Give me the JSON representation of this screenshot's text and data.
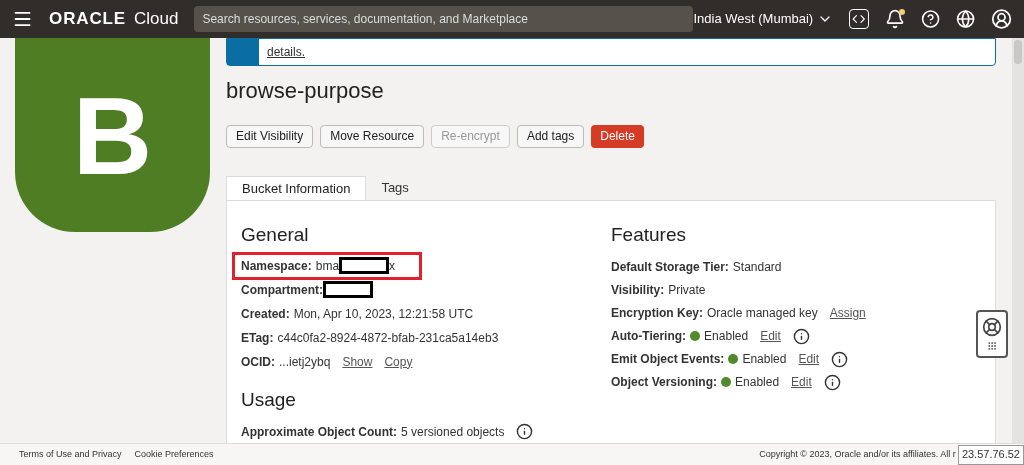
{
  "header": {
    "brand": "ORACLE",
    "product": "Cloud",
    "search": {
      "placeholder": "Search resources, services, documentation, and Marketplace"
    },
    "region": "India West (Mumbai)",
    "notification": true
  },
  "banner": {
    "link": "details."
  },
  "bucket": {
    "letter": "B",
    "title": "browse-purpose"
  },
  "actions": [
    {
      "label": "Edit Visibility",
      "kind": "default",
      "disabled": false
    },
    {
      "label": "Move Resource",
      "kind": "default",
      "disabled": false
    },
    {
      "label": "Re-encrypt",
      "kind": "default",
      "disabled": true
    },
    {
      "label": "Add tags",
      "kind": "default",
      "disabled": false
    },
    {
      "label": "Delete",
      "kind": "danger",
      "disabled": false
    }
  ],
  "tabs": [
    {
      "label": "Bucket Information",
      "selected": true
    },
    {
      "label": "Tags",
      "selected": false
    }
  ],
  "general": {
    "heading": "General",
    "rows": [
      {
        "label": "Namespace:",
        "before": "bma",
        "after": "x",
        "redacted": true,
        "highlighted": true
      },
      {
        "label": "Compartment:",
        "redacted": true
      },
      {
        "label": "Created:",
        "value": "Mon, Apr 10, 2023, 12:21:58 UTC"
      },
      {
        "label": "ETag:",
        "value": "c44c0fa2-8924-4872-bfab-231ca5a14eb3"
      },
      {
        "label": "OCID:",
        "value": "...ietj2ybq",
        "links": [
          "Show",
          "Copy"
        ]
      }
    ]
  },
  "usage": {
    "heading": "Usage",
    "rows": [
      {
        "label": "Approximate Object Count:",
        "value": "5 versioned objects",
        "info": true
      }
    ]
  },
  "features": {
    "heading": "Features",
    "rows": [
      {
        "label": "Default Storage Tier:",
        "value": "Standard"
      },
      {
        "label": "Visibility:",
        "value": "Private"
      },
      {
        "label": "Encryption Key:",
        "value": "Oracle managed key",
        "link": "Assign"
      },
      {
        "label": "Auto-Tiering:",
        "value": "Enabled",
        "enabled": true,
        "link": "Edit",
        "info": true
      },
      {
        "label": "Emit Object Events:",
        "value": "Enabled",
        "enabled": true,
        "link": "Edit",
        "info": true
      },
      {
        "label": "Object Versioning:",
        "value": "Enabled",
        "enabled": true,
        "link": "Edit",
        "info": true
      }
    ]
  },
  "footer": {
    "links": [
      "Terms of Use and Privacy",
      "Cookie Preferences"
    ],
    "copyright": "Copyright © 2023, Oracle and/or its affiliates. All r",
    "ip": "23.57.76.52"
  }
}
